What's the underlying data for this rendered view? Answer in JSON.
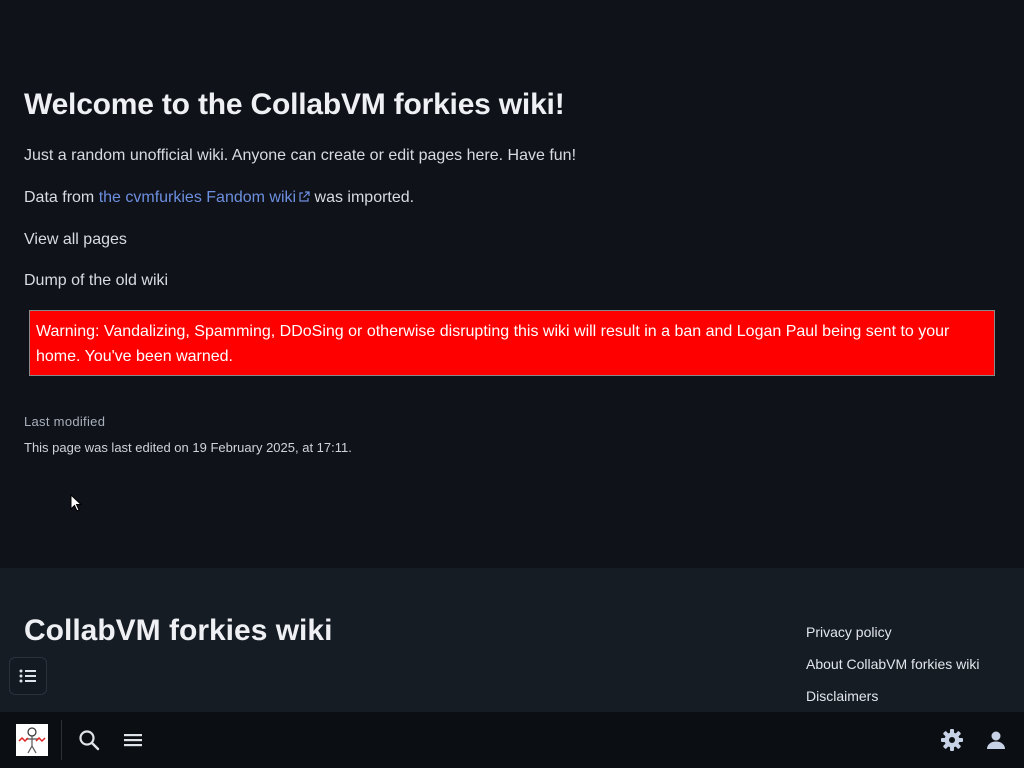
{
  "page": {
    "title": "Welcome to the CollabVM forkies wiki!",
    "intro": "Just a random unofficial wiki. Anyone can create or edit pages here. Have fun!",
    "data_prefix": "Data from ",
    "data_link": "the cvmfurkies Fandom wiki",
    "data_suffix": " was imported.",
    "view_all": "View all pages",
    "dump_link": "Dump of the old wiki",
    "warning": "Warning: Vandalizing, Spamming, DDoSing or otherwise disrupting this wiki will result in a ban and Logan Paul being sent to your home. You've been warned.",
    "last_modified_label": "Last modified",
    "last_modified_text": "This page was last edited on 19 February 2025, at 17:11."
  },
  "footer": {
    "site_title": "CollabVM forkies wiki",
    "links": [
      "Privacy policy",
      "About CollabVM forkies wiki",
      "Disclaimers"
    ]
  },
  "icons": {
    "toc": "list-icon",
    "search": "search-icon",
    "menu": "hamburger-menu-icon",
    "settings": "gear-icon",
    "user": "user-icon"
  },
  "colors": {
    "background": "#0f1218",
    "link": "#6d8fe0",
    "warning_bg": "#ff0000",
    "footer_bg": "#161c24"
  }
}
